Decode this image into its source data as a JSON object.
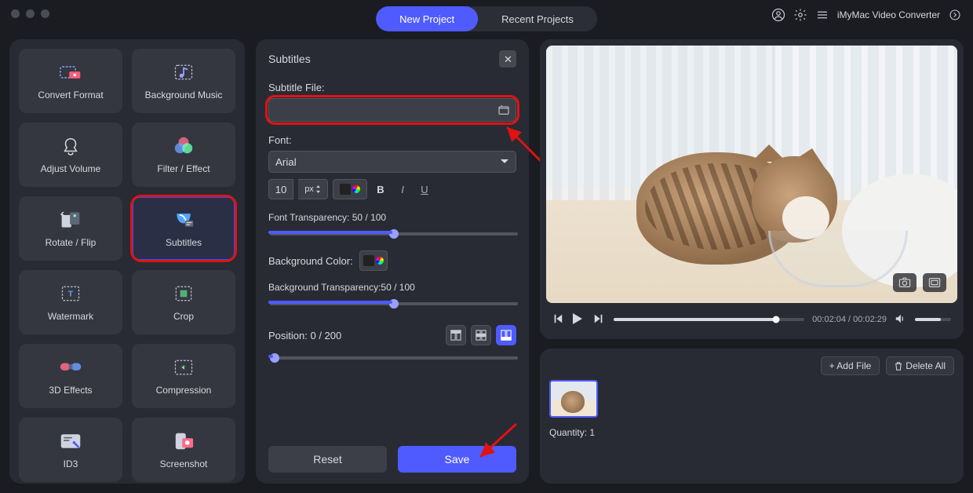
{
  "app": {
    "name": "iMyMac Video Converter"
  },
  "topTabs": {
    "new": "New Project",
    "recent": "Recent Projects"
  },
  "tools": [
    {
      "id": "convert-format",
      "label": "Convert Format"
    },
    {
      "id": "background-music",
      "label": "Background Music"
    },
    {
      "id": "adjust-volume",
      "label": "Adjust Volume"
    },
    {
      "id": "filter-effect",
      "label": "Filter / Effect"
    },
    {
      "id": "rotate-flip",
      "label": "Rotate / Flip"
    },
    {
      "id": "subtitles",
      "label": "Subtitles",
      "selected": true
    },
    {
      "id": "watermark",
      "label": "Watermark"
    },
    {
      "id": "crop",
      "label": "Crop"
    },
    {
      "id": "3d-effects",
      "label": "3D Effects"
    },
    {
      "id": "compression",
      "label": "Compression"
    },
    {
      "id": "id3",
      "label": "ID3"
    },
    {
      "id": "screenshot",
      "label": "Screenshot"
    }
  ],
  "panel": {
    "title": "Subtitles",
    "subtitleFileLabel": "Subtitle File:",
    "subtitleFileValue": "",
    "fontLabel": "Font:",
    "fontName": "Arial",
    "fontSize": "10",
    "fontUnit": "px",
    "boldLabel": "B",
    "italicLabel": "I",
    "underlineLabel": "U",
    "fontTransparencyLabel": "Font Transparency: 50 / 100",
    "fontTransparency": 50,
    "bgColorLabel": "Background Color:",
    "bgTransparencyLabel": "Background Transparency:50 / 100",
    "bgTransparency": 50,
    "positionLabel": "Position: 0 / 200",
    "position": 0,
    "resetLabel": "Reset",
    "saveLabel": "Save"
  },
  "transport": {
    "current": "00:02:04",
    "total": "00:02:29",
    "sep": " / "
  },
  "fileArea": {
    "addFile": "+ Add File",
    "deleteAll": "Delete All",
    "quantityLabel": "Quantity:",
    "quantity": "1"
  }
}
